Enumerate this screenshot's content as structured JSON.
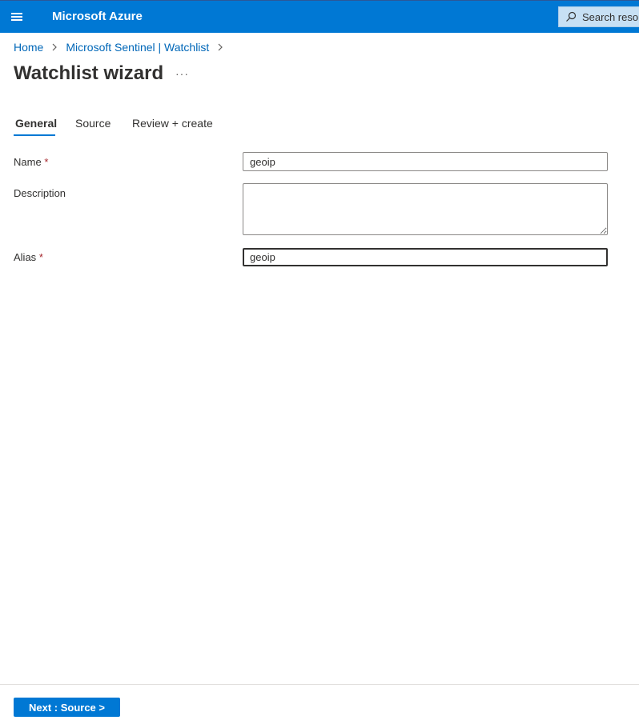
{
  "topbar": {
    "brand": "Microsoft Azure",
    "search_placeholder": "Search resou",
    "accent_color": "#0078d4"
  },
  "breadcrumb": {
    "items": [
      "Home",
      "Microsoft Sentinel | Watchlist"
    ]
  },
  "page": {
    "title": "Watchlist wizard",
    "more": "···"
  },
  "tabs": [
    {
      "label": "General",
      "active": true
    },
    {
      "label": "Source",
      "active": false
    },
    {
      "label": "Review + create",
      "active": false
    }
  ],
  "form": {
    "name_label": "Name",
    "name_value": "geoip",
    "description_label": "Description",
    "description_value": "",
    "alias_label": "Alias",
    "alias_value": "geoip",
    "required_marker": "*"
  },
  "footer": {
    "next_label": "Next : Source >"
  },
  "icons": {
    "menu": "hamburger-menu-icon",
    "search": "search-icon",
    "chevron": "chevron-right-icon"
  }
}
